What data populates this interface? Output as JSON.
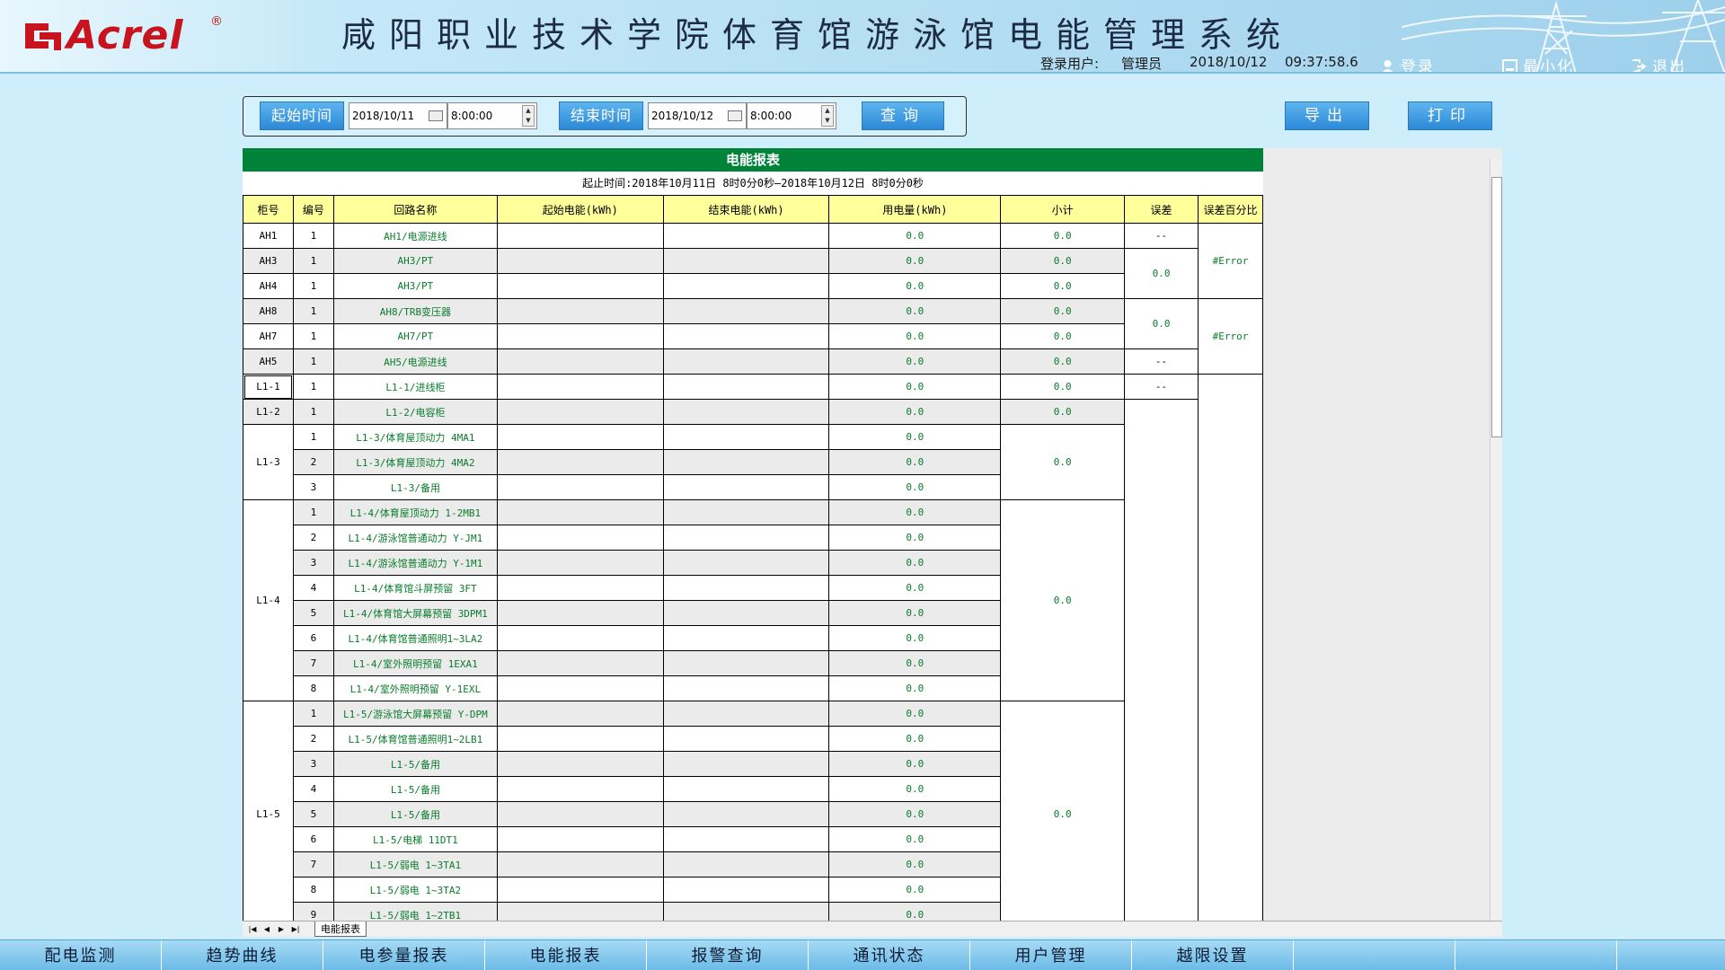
{
  "header": {
    "logo_text": "Acrel",
    "logo_reg": "®",
    "title": "咸阳职业技术学院体育馆游泳馆电能管理系统",
    "user_label": "登录用户:",
    "user_name": "管理员",
    "date": "2018/10/12",
    "time": "09:37:58.6",
    "login_label": "登录",
    "minimize_label": "最小化",
    "exit_label": "退出"
  },
  "query": {
    "start_label": "起始时间",
    "start_date": "2018/10/11",
    "start_time": "8:00:00",
    "end_label": "结束时间",
    "end_date": "2018/10/12",
    "end_time": "8:00:00",
    "query_label": "查询",
    "export_label": "导出",
    "print_label": "打印"
  },
  "report": {
    "title": "电能报表",
    "period": "起止时间:2018年10月11日 8时0分0秒—2018年10月12日 8时0分0秒",
    "columns": [
      "柜号",
      "编号",
      "回路名称",
      "起始电能(kWh)",
      "结束电能(kWh)",
      "用电量(kWh)",
      "小计",
      "误差",
      "误差百分比"
    ],
    "rows": [
      {
        "cab": "AH1",
        "no": "1",
        "name": "AH1/电源进线",
        "usage": "0.0"
      },
      {
        "cab": "AH3",
        "no": "1",
        "name": "AH3/PT",
        "usage": "0.0"
      },
      {
        "cab": "AH4",
        "no": "1",
        "name": "AH3/PT",
        "usage": "0.0"
      },
      {
        "cab": "AH8",
        "no": "1",
        "name": "AH8/TRB变压器",
        "usage": "0.0"
      },
      {
        "cab": "AH7",
        "no": "1",
        "name": "AH7/PT",
        "usage": "0.0"
      },
      {
        "cab": "AH5",
        "no": "1",
        "name": "AH5/电源进线",
        "usage": "0.0"
      },
      {
        "cab": "L1-1",
        "no": "1",
        "name": "L1-1/进线柜",
        "usage": "0.0"
      },
      {
        "cab": "L1-2",
        "no": "1",
        "name": "L1-2/电容柜",
        "usage": "0.0"
      },
      {
        "cab": "L1-3",
        "no": "1",
        "name": "L1-3/体育屋顶动力 4MA1",
        "usage": "0.0"
      },
      {
        "cab": "",
        "no": "2",
        "name": "L1-3/体育屋顶动力 4MA2",
        "usage": "0.0"
      },
      {
        "cab": "",
        "no": "3",
        "name": "L1-3/备用",
        "usage": "0.0"
      },
      {
        "cab": "L1-4",
        "no": "1",
        "name": "L1-4/体育屋顶动力 1-2MB1",
        "usage": "0.0"
      },
      {
        "cab": "",
        "no": "2",
        "name": "L1-4/游泳馆普通动力 Y-JM1",
        "usage": "0.0"
      },
      {
        "cab": "",
        "no": "3",
        "name": "L1-4/游泳馆普通动力 Y-1M1",
        "usage": "0.0"
      },
      {
        "cab": "",
        "no": "4",
        "name": "L1-4/体育馆斗屏预留 3FT",
        "usage": "0.0"
      },
      {
        "cab": "",
        "no": "5",
        "name": "L1-4/体育馆大屏幕预留 3DPM1",
        "usage": "0.0"
      },
      {
        "cab": "",
        "no": "6",
        "name": "L1-4/体育馆普通照明1~3LA2",
        "usage": "0.0"
      },
      {
        "cab": "",
        "no": "7",
        "name": "L1-4/室外照明预留 1EXA1",
        "usage": "0.0"
      },
      {
        "cab": "",
        "no": "8",
        "name": "L1-4/室外照明预留 Y-1EXL",
        "usage": "0.0"
      },
      {
        "cab": "L1-5",
        "no": "1",
        "name": "L1-5/游泳馆大屏幕预留 Y-DPM",
        "usage": "0.0"
      },
      {
        "cab": "",
        "no": "2",
        "name": "L1-5/体育馆普通照明1~2LB1",
        "usage": "0.0"
      },
      {
        "cab": "",
        "no": "3",
        "name": "L1-5/备用",
        "usage": "0.0"
      },
      {
        "cab": "",
        "no": "4",
        "name": "L1-5/备用",
        "usage": "0.0"
      },
      {
        "cab": "",
        "no": "5",
        "name": "L1-5/备用",
        "usage": "0.0"
      },
      {
        "cab": "",
        "no": "6",
        "name": "L1-5/电梯 11DT1",
        "usage": "0.0"
      },
      {
        "cab": "",
        "no": "7",
        "name": "L1-5/弱电 1~3TA1",
        "usage": "0.0"
      },
      {
        "cab": "",
        "no": "8",
        "name": "L1-5/弱电 1~3TA2",
        "usage": "0.0"
      },
      {
        "cab": "",
        "no": "9",
        "name": "L1-5/弱电 1~2TB1",
        "usage": "0.0"
      }
    ],
    "subtotals": [
      "0.0",
      "0.0",
      "0.0",
      "0.0",
      "0.0",
      "0.0",
      "0.0",
      "0.0",
      "0.0",
      "0.0",
      "0.0"
    ],
    "errors": [
      "--",
      "0.0",
      "0.0",
      "--",
      "--"
    ],
    "error_pcts": [
      "#Error",
      "#Error"
    ],
    "sheet_tab": "电能报表"
  },
  "nav": {
    "items": [
      "配电监测",
      "趋势曲线",
      "电参量报表",
      "电能报表",
      "报警查询",
      "通讯状态",
      "用户管理",
      "越限设置"
    ]
  },
  "colors": {
    "title_bar": "#008239",
    "header_row": "#ffff9c",
    "value_text": "#0a7c2c",
    "logo": "#c8141e",
    "button": "#2d89d8"
  }
}
